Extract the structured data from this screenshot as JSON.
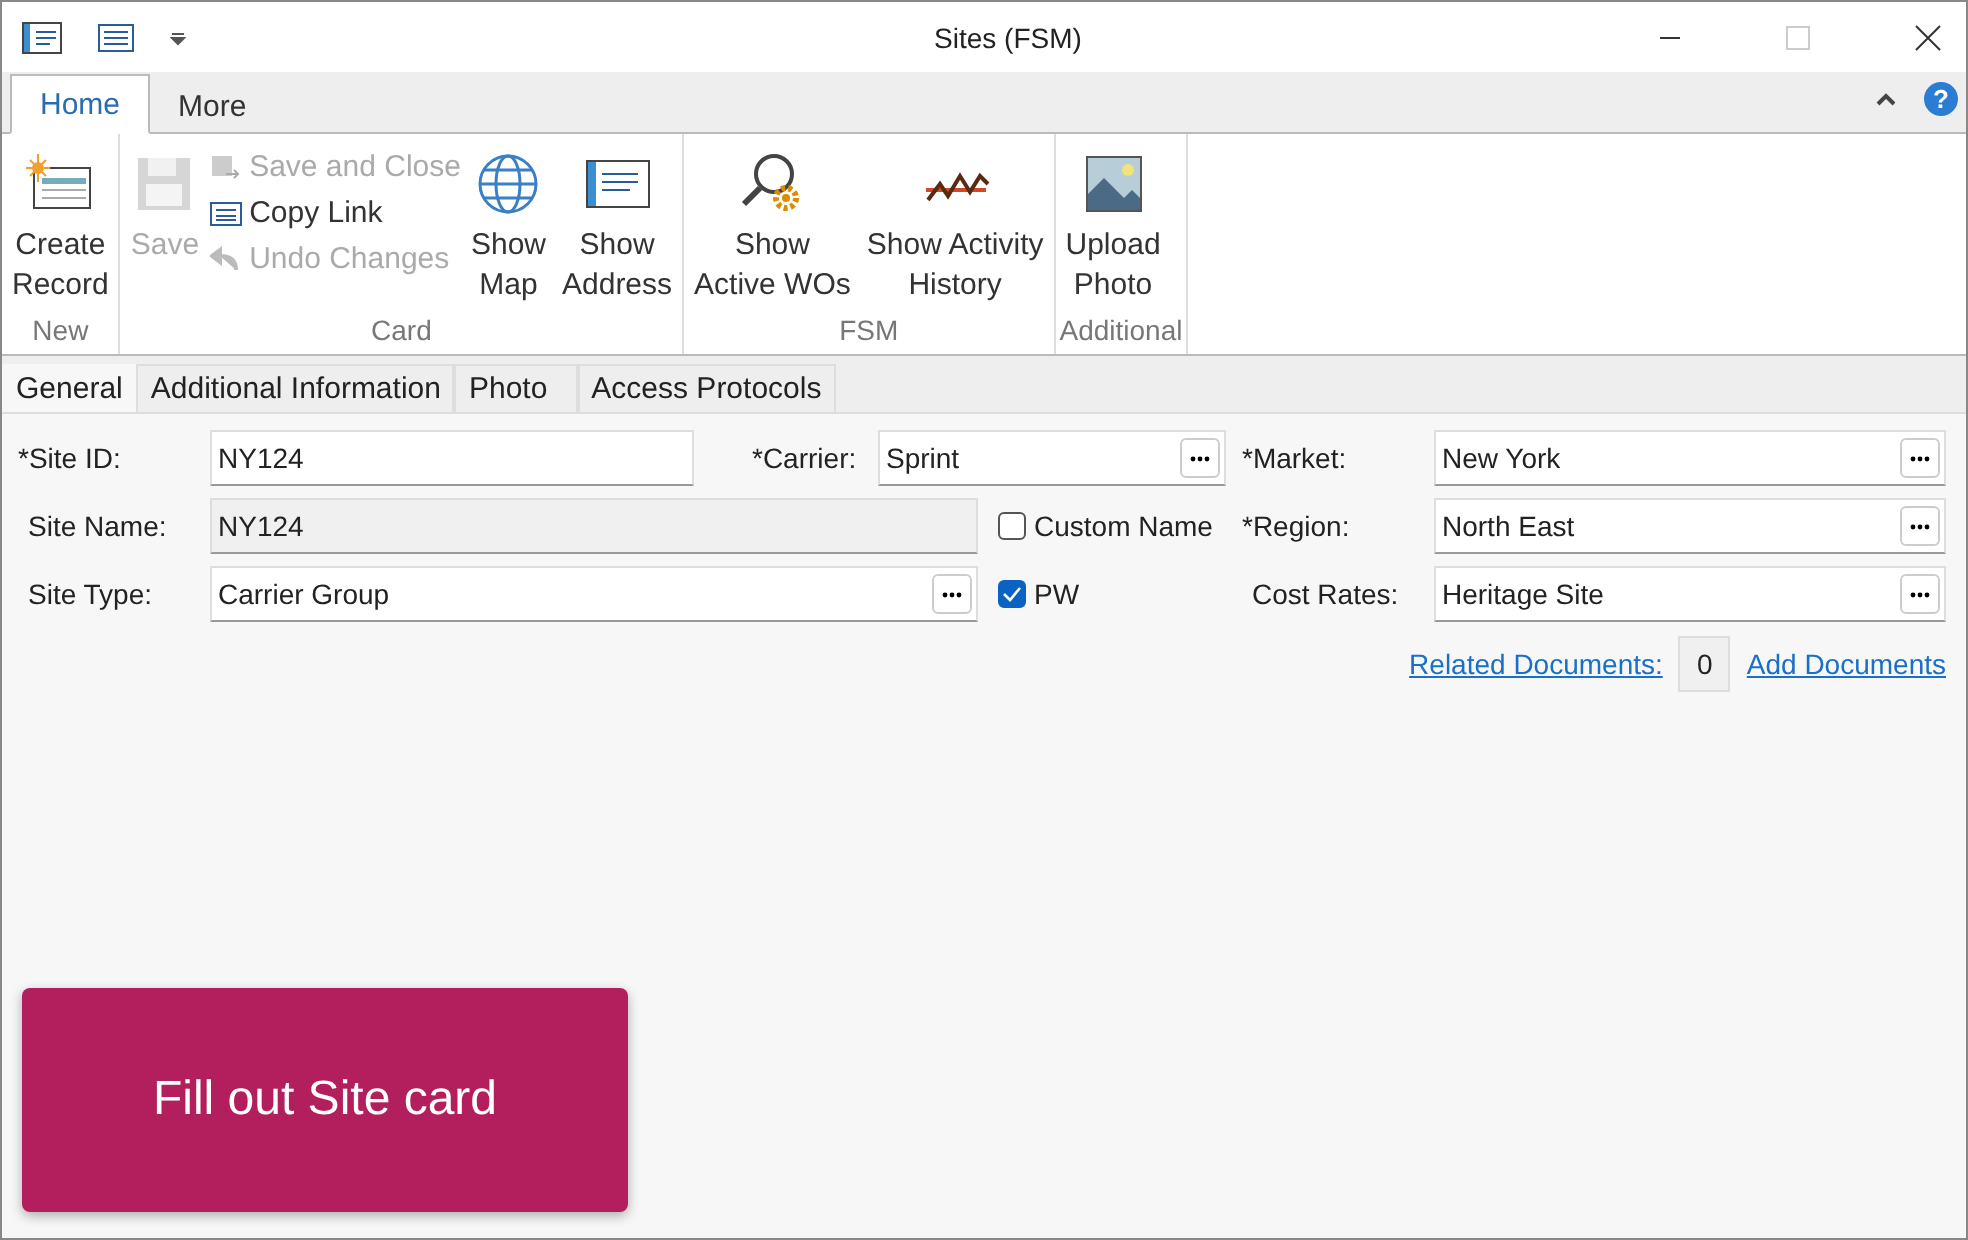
{
  "window": {
    "title": "Sites (FSM)"
  },
  "ribbon_tabs": [
    {
      "label": "Home",
      "selected": true
    },
    {
      "label": "More",
      "selected": false
    }
  ],
  "help": "?",
  "ribbon_groups": [
    {
      "label": "New",
      "buttons": [
        {
          "kind": "large",
          "label": "Create\nRecord",
          "disabled": false
        }
      ]
    },
    {
      "label": "Card",
      "buttons": [
        {
          "kind": "large",
          "label": "Save",
          "disabled": true
        },
        {
          "kind": "stack",
          "items": [
            {
              "label": "Save and Close",
              "disabled": true
            },
            {
              "label": "Copy Link",
              "disabled": false
            },
            {
              "label": "Undo Changes",
              "disabled": true
            }
          ]
        },
        {
          "kind": "large",
          "label": "Show\nMap",
          "disabled": false
        },
        {
          "kind": "large",
          "label": "Show\nAddress",
          "disabled": false
        }
      ]
    },
    {
      "label": "FSM",
      "buttons": [
        {
          "kind": "large",
          "label": "Show\nActive WOs",
          "disabled": false
        },
        {
          "kind": "large",
          "label": "Show Activity\nHistory",
          "disabled": false
        }
      ]
    },
    {
      "label": "Additional",
      "buttons": [
        {
          "kind": "large",
          "label": "Upload\nPhoto",
          "disabled": false
        }
      ]
    }
  ],
  "doc_tabs": [
    {
      "label": "General",
      "selected": true
    },
    {
      "label": "Additional Information",
      "selected": false
    },
    {
      "label": "Photo",
      "selected": false
    },
    {
      "label": "Access Protocols",
      "selected": false
    }
  ],
  "left_rows": [
    [
      {
        "kind": "text",
        "label": "*Site ID:",
        "value": "NY124"
      },
      {
        "kind": "lookup",
        "label": "*Carrier:",
        "value": "Sprint"
      }
    ],
    [
      {
        "kind": "readonly",
        "label": "Site Name:",
        "value": "NY124"
      },
      {
        "kind": "checkbox",
        "label": "Custom Name",
        "checked": false
      }
    ],
    [
      {
        "kind": "lookup",
        "label": "Site Type:",
        "value": "Carrier Group"
      },
      {
        "kind": "checkbox",
        "label": "PW",
        "checked": true
      }
    ]
  ],
  "right_fields": [
    {
      "kind": "lookup",
      "label": "*Market:",
      "value": "New York"
    },
    {
      "kind": "lookup",
      "label": "*Region:",
      "value": "North East"
    },
    {
      "kind": "lookup",
      "label": "Cost Rates:",
      "value": "Heritage Site"
    }
  ],
  "related_documents": {
    "label": "Related Documents:",
    "count": "0"
  },
  "add_documents": "Add Documents",
  "action_button": "Fill out Site card"
}
